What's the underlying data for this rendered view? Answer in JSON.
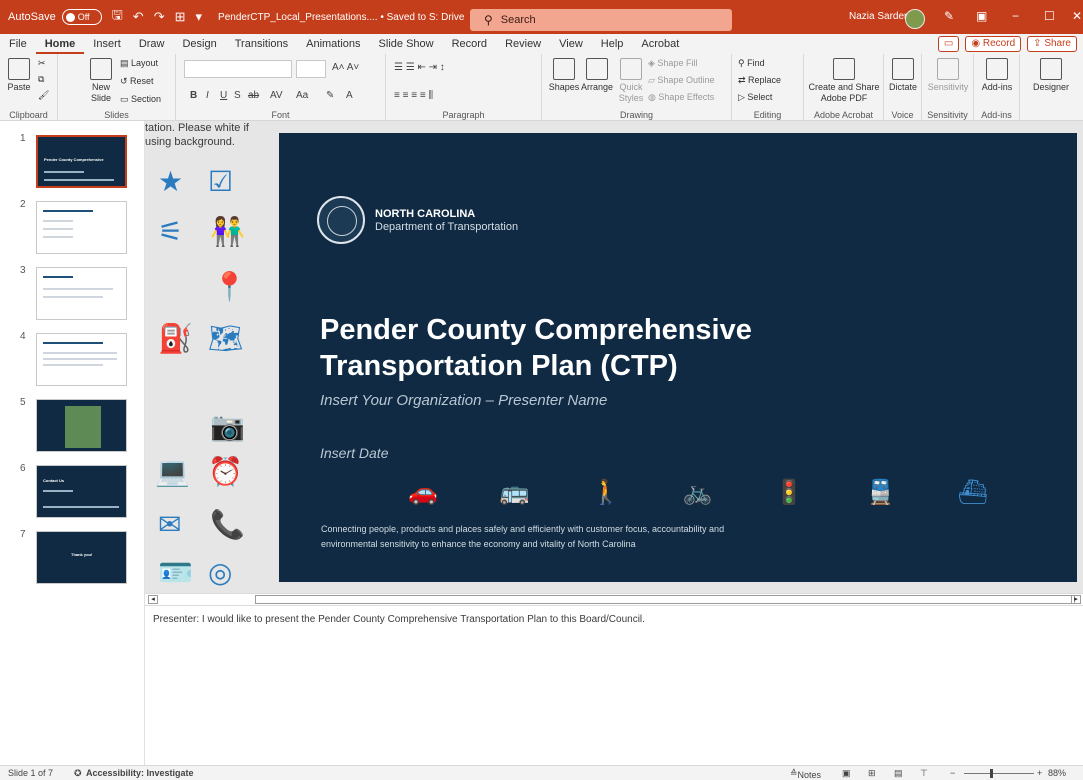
{
  "titlebar": {
    "autosave_label": "AutoSave",
    "autosave_state": "Off",
    "filename": "PenderCTP_Local_Presentations.... • Saved to S: Drive",
    "search_placeholder": "Search",
    "user_name": "Nazia Sarder"
  },
  "tabs": [
    "File",
    "Home",
    "Insert",
    "Draw",
    "Design",
    "Transitions",
    "Animations",
    "Slide Show",
    "Record",
    "Review",
    "View",
    "Help",
    "Acrobat"
  ],
  "tabs_right": {
    "record": "Record",
    "share": "Share"
  },
  "ribbon": {
    "paste": "Paste",
    "layout": "Layout",
    "reset": "Reset",
    "new_slide": "New Slide",
    "section": "Section",
    "shapes": "Shapes",
    "arrange": "Arrange",
    "quick_styles": "Quick Styles",
    "shape_fill": "Shape Fill",
    "shape_outline": "Shape Outline",
    "shape_effects": "Shape Effects",
    "find": "Find",
    "replace": "Replace",
    "select": "Select",
    "create_share": "Create and Share Adobe PDF",
    "dictate": "Dictate",
    "sensitivity": "Sensitivity",
    "addins": "Add-ins",
    "designer": "Designer",
    "groups": {
      "clipboard": "Clipboard",
      "slides": "Slides",
      "font": "Font",
      "paragraph": "Paragraph",
      "drawing": "Drawing",
      "editing": "Editing",
      "acrobat": "Adobe Acrobat",
      "voice": "Voice",
      "sensitivity": "Sensitivity",
      "addins": "Add-ins"
    }
  },
  "thumbnails": [
    "1",
    "2",
    "3",
    "4",
    "5",
    "6",
    "7"
  ],
  "offslide_text": "tation. Please white if using background.",
  "slide": {
    "org_title": "NORTH CAROLINA",
    "org_sub": "Department of Transportation",
    "title": "Pender County Comprehensive Transportation Plan (CTP)",
    "subtitle": "Insert Your Organization – Presenter Name",
    "date": "Insert Date",
    "tagline": "Connecting people, products and places safely and efficiently with customer focus, accountability and environmental sensitivity to enhance the economy and vitality of North Carolina"
  },
  "notes": "Presenter: I would like to present the Pender County Comprehensive Transportation Plan to this Board/Council.",
  "status": {
    "slide_counter": "Slide 1 of 7",
    "accessibility": "Accessibility: Investigate",
    "notes_btn": "Notes",
    "zoom": "88%"
  },
  "colors": {
    "accent": "#c43e1c",
    "slide_bg": "#0f2a42",
    "icon_blue": "#2b7bbf"
  }
}
